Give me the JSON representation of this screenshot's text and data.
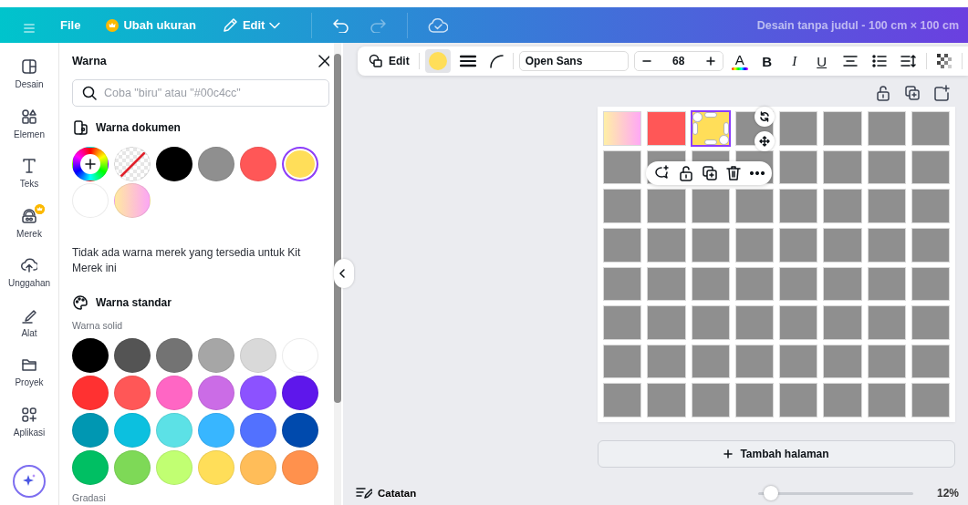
{
  "header": {
    "items": [
      {
        "kind": "text",
        "label": "File"
      },
      {
        "kind": "premium",
        "label": "Ubah ukuran"
      },
      {
        "kind": "dropdown",
        "label": "Edit"
      }
    ],
    "undo": {
      "disabled": false
    },
    "redo": {
      "disabled": true
    },
    "title": "Desain tanpa judul - 100 cm × 100 cm"
  },
  "rail": {
    "items": [
      {
        "kind": "layout",
        "label": "Desain",
        "premium": false
      },
      {
        "kind": "shapes",
        "label": "Elemen",
        "premium": false
      },
      {
        "kind": "text",
        "label": "Teks",
        "premium": false
      },
      {
        "kind": "brand",
        "label": "Merek",
        "premium": true
      },
      {
        "kind": "upload",
        "label": "Unggahan",
        "premium": false
      },
      {
        "kind": "draw",
        "label": "Alat",
        "premium": false
      },
      {
        "kind": "folder",
        "label": "Proyek",
        "premium": false
      },
      {
        "kind": "apps",
        "label": "Aplikasi",
        "premium": false
      }
    ]
  },
  "panel": {
    "title": "Warna",
    "search": {
      "placeholder": "Coba \"biru\" atau \"#00c4cc\""
    },
    "document_colors": {
      "heading": "Warna dokumen",
      "swatches": [
        {
          "kind": "picker",
          "selected": false
        },
        {
          "kind": "none",
          "selected": false
        },
        {
          "kind": "solid",
          "color": "#000000",
          "selected": false
        },
        {
          "kind": "solid",
          "color": "#8f8f8f",
          "selected": false
        },
        {
          "kind": "solid",
          "color": "#ff5757",
          "selected": false
        },
        {
          "kind": "solid",
          "color": "#ffde59",
          "selected": true
        },
        {
          "kind": "solid",
          "color": "#ffffff",
          "selected": false
        },
        {
          "kind": "gradient",
          "selected": false
        }
      ]
    },
    "brand_note": "Tidak ada warna merek yang tersedia untuk Kit Merek ini",
    "standard": {
      "heading": "Warna standar",
      "solid_label": "Warna solid",
      "colors": [
        {
          "color": "#000000"
        },
        {
          "color": "#545454"
        },
        {
          "color": "#737373"
        },
        {
          "color": "#a6a6a6"
        },
        {
          "color": "#d9d9d9"
        },
        {
          "color": "#ffffff"
        },
        {
          "color": "#ff3131"
        },
        {
          "color": "#ff5757"
        },
        {
          "color": "#ff66c4"
        },
        {
          "color": "#cb6ce6"
        },
        {
          "color": "#8c52ff"
        },
        {
          "color": "#5e17eb"
        },
        {
          "color": "#0097b2"
        },
        {
          "color": "#0cc0df"
        },
        {
          "color": "#5ce1e6"
        },
        {
          "color": "#38b6ff"
        },
        {
          "color": "#5271ff"
        },
        {
          "color": "#004aad"
        },
        {
          "color": "#00bf63"
        },
        {
          "color": "#7ed957"
        },
        {
          "color": "#c1ff72"
        },
        {
          "color": "#ffde59"
        },
        {
          "color": "#ffbd59"
        },
        {
          "color": "#ff914d"
        }
      ],
      "gradient_label": "Gradasi"
    }
  },
  "toolbar": {
    "edit_label": "Edit",
    "fill": {
      "color": "#ffde59"
    },
    "font": "Open Sans",
    "size": "68",
    "text_color_label": "A",
    "format_buttons": [
      "B",
      "I",
      "U"
    ]
  },
  "canvas": {
    "rows": [
      {
        "cells": [
          {
            "kind": "gradient",
            "selected": false
          },
          {
            "kind": "solid",
            "color": "#ff5757",
            "selected": false
          },
          {
            "kind": "solid",
            "color": "#ffde59",
            "selected": true
          },
          {
            "kind": "solid",
            "color": "#8f8f8f",
            "selected": false
          },
          {
            "kind": "solid",
            "color": "#8f8f8f",
            "selected": false
          },
          {
            "kind": "solid",
            "color": "#8f8f8f",
            "selected": false
          },
          {
            "kind": "solid",
            "color": "#8f8f8f",
            "selected": false
          },
          {
            "kind": "solid",
            "color": "#8f8f8f",
            "selected": false
          }
        ]
      },
      {
        "cells": [
          {
            "kind": "solid",
            "color": "#8f8f8f",
            "selected": false
          },
          {
            "kind": "solid",
            "color": "#8f8f8f",
            "selected": false
          },
          {
            "kind": "solid",
            "color": "#8f8f8f",
            "selected": false
          },
          {
            "kind": "solid",
            "color": "#8f8f8f",
            "selected": false
          },
          {
            "kind": "solid",
            "color": "#8f8f8f",
            "selected": false
          },
          {
            "kind": "solid",
            "color": "#8f8f8f",
            "selected": false
          },
          {
            "kind": "solid",
            "color": "#8f8f8f",
            "selected": false
          },
          {
            "kind": "solid",
            "color": "#8f8f8f",
            "selected": false
          }
        ]
      },
      {
        "cells": [
          {
            "kind": "solid",
            "color": "#8f8f8f",
            "selected": false
          },
          {
            "kind": "solid",
            "color": "#8f8f8f",
            "selected": false
          },
          {
            "kind": "solid",
            "color": "#8f8f8f",
            "selected": false
          },
          {
            "kind": "solid",
            "color": "#8f8f8f",
            "selected": false
          },
          {
            "kind": "solid",
            "color": "#8f8f8f",
            "selected": false
          },
          {
            "kind": "solid",
            "color": "#8f8f8f",
            "selected": false
          },
          {
            "kind": "solid",
            "color": "#8f8f8f",
            "selected": false
          },
          {
            "kind": "solid",
            "color": "#8f8f8f",
            "selected": false
          }
        ]
      },
      {
        "cells": [
          {
            "kind": "solid",
            "color": "#8f8f8f",
            "selected": false
          },
          {
            "kind": "solid",
            "color": "#8f8f8f",
            "selected": false
          },
          {
            "kind": "solid",
            "color": "#8f8f8f",
            "selected": false
          },
          {
            "kind": "solid",
            "color": "#8f8f8f",
            "selected": false
          },
          {
            "kind": "solid",
            "color": "#8f8f8f",
            "selected": false
          },
          {
            "kind": "solid",
            "color": "#8f8f8f",
            "selected": false
          },
          {
            "kind": "solid",
            "color": "#8f8f8f",
            "selected": false
          },
          {
            "kind": "solid",
            "color": "#8f8f8f",
            "selected": false
          }
        ]
      },
      {
        "cells": [
          {
            "kind": "solid",
            "color": "#8f8f8f",
            "selected": false
          },
          {
            "kind": "solid",
            "color": "#8f8f8f",
            "selected": false
          },
          {
            "kind": "solid",
            "color": "#8f8f8f",
            "selected": false
          },
          {
            "kind": "solid",
            "color": "#8f8f8f",
            "selected": false
          },
          {
            "kind": "solid",
            "color": "#8f8f8f",
            "selected": false
          },
          {
            "kind": "solid",
            "color": "#8f8f8f",
            "selected": false
          },
          {
            "kind": "solid",
            "color": "#8f8f8f",
            "selected": false
          },
          {
            "kind": "solid",
            "color": "#8f8f8f",
            "selected": false
          }
        ]
      },
      {
        "cells": [
          {
            "kind": "solid",
            "color": "#8f8f8f",
            "selected": false
          },
          {
            "kind": "solid",
            "color": "#8f8f8f",
            "selected": false
          },
          {
            "kind": "solid",
            "color": "#8f8f8f",
            "selected": false
          },
          {
            "kind": "solid",
            "color": "#8f8f8f",
            "selected": false
          },
          {
            "kind": "solid",
            "color": "#8f8f8f",
            "selected": false
          },
          {
            "kind": "solid",
            "color": "#8f8f8f",
            "selected": false
          },
          {
            "kind": "solid",
            "color": "#8f8f8f",
            "selected": false
          },
          {
            "kind": "solid",
            "color": "#8f8f8f",
            "selected": false
          }
        ]
      },
      {
        "cells": [
          {
            "kind": "solid",
            "color": "#8f8f8f",
            "selected": false
          },
          {
            "kind": "solid",
            "color": "#8f8f8f",
            "selected": false
          },
          {
            "kind": "solid",
            "color": "#8f8f8f",
            "selected": false
          },
          {
            "kind": "solid",
            "color": "#8f8f8f",
            "selected": false
          },
          {
            "kind": "solid",
            "color": "#8f8f8f",
            "selected": false
          },
          {
            "kind": "solid",
            "color": "#8f8f8f",
            "selected": false
          },
          {
            "kind": "solid",
            "color": "#8f8f8f",
            "selected": false
          },
          {
            "kind": "solid",
            "color": "#8f8f8f",
            "selected": false
          }
        ]
      },
      {
        "cells": [
          {
            "kind": "solid",
            "color": "#8f8f8f",
            "selected": false
          },
          {
            "kind": "solid",
            "color": "#8f8f8f",
            "selected": false
          },
          {
            "kind": "solid",
            "color": "#8f8f8f",
            "selected": false
          },
          {
            "kind": "solid",
            "color": "#8f8f8f",
            "selected": false
          },
          {
            "kind": "solid",
            "color": "#8f8f8f",
            "selected": false
          },
          {
            "kind": "solid",
            "color": "#8f8f8f",
            "selected": false
          },
          {
            "kind": "solid",
            "color": "#8f8f8f",
            "selected": false
          },
          {
            "kind": "solid",
            "color": "#8f8f8f",
            "selected": false
          }
        ]
      }
    ]
  },
  "add_page": "Tambah halaman",
  "footer": {
    "notes": "Catatan",
    "zoom": {
      "level": 0.08,
      "reading": "12%"
    }
  }
}
